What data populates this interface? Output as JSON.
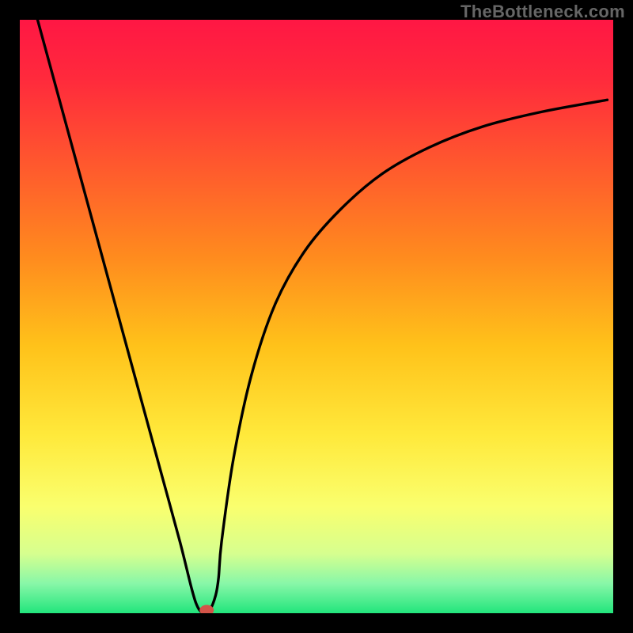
{
  "watermark": "TheBottleneck.com",
  "chart_data": {
    "type": "line",
    "title": "",
    "xlabel": "",
    "ylabel": "",
    "xlim": [
      0,
      100
    ],
    "ylim": [
      0,
      100
    ],
    "background_gradient": {
      "stops": [
        {
          "offset": 0.0,
          "color": "#ff1744"
        },
        {
          "offset": 0.1,
          "color": "#ff2a3c"
        },
        {
          "offset": 0.25,
          "color": "#ff5a2d"
        },
        {
          "offset": 0.4,
          "color": "#ff8b1e"
        },
        {
          "offset": 0.55,
          "color": "#ffc21a"
        },
        {
          "offset": 0.7,
          "color": "#ffe93b"
        },
        {
          "offset": 0.82,
          "color": "#faff6e"
        },
        {
          "offset": 0.9,
          "color": "#d6ff8f"
        },
        {
          "offset": 0.95,
          "color": "#88f7a8"
        },
        {
          "offset": 1.0,
          "color": "#22e57c"
        }
      ]
    },
    "series": [
      {
        "name": "bottleneck-curve",
        "color": "#000000",
        "x": [
          3,
          6,
          9,
          12,
          15,
          18,
          21,
          24,
          27,
          29,
          30,
          31,
          32,
          33,
          33.5,
          34,
          36,
          39,
          43,
          48,
          54,
          61,
          69,
          78,
          88,
          99
        ],
        "y": [
          100,
          89,
          78,
          67,
          56,
          45,
          34,
          23,
          12,
          4,
          1,
          0,
          0.5,
          3,
          6,
          12,
          26,
          40,
          52,
          61,
          68,
          74,
          78.5,
          82,
          84.5,
          86.5
        ]
      }
    ],
    "marker": {
      "name": "optimal-point",
      "x": 31.5,
      "y": 0.5,
      "color": "#d35448",
      "rx": 1.2,
      "ry": 0.9
    }
  }
}
